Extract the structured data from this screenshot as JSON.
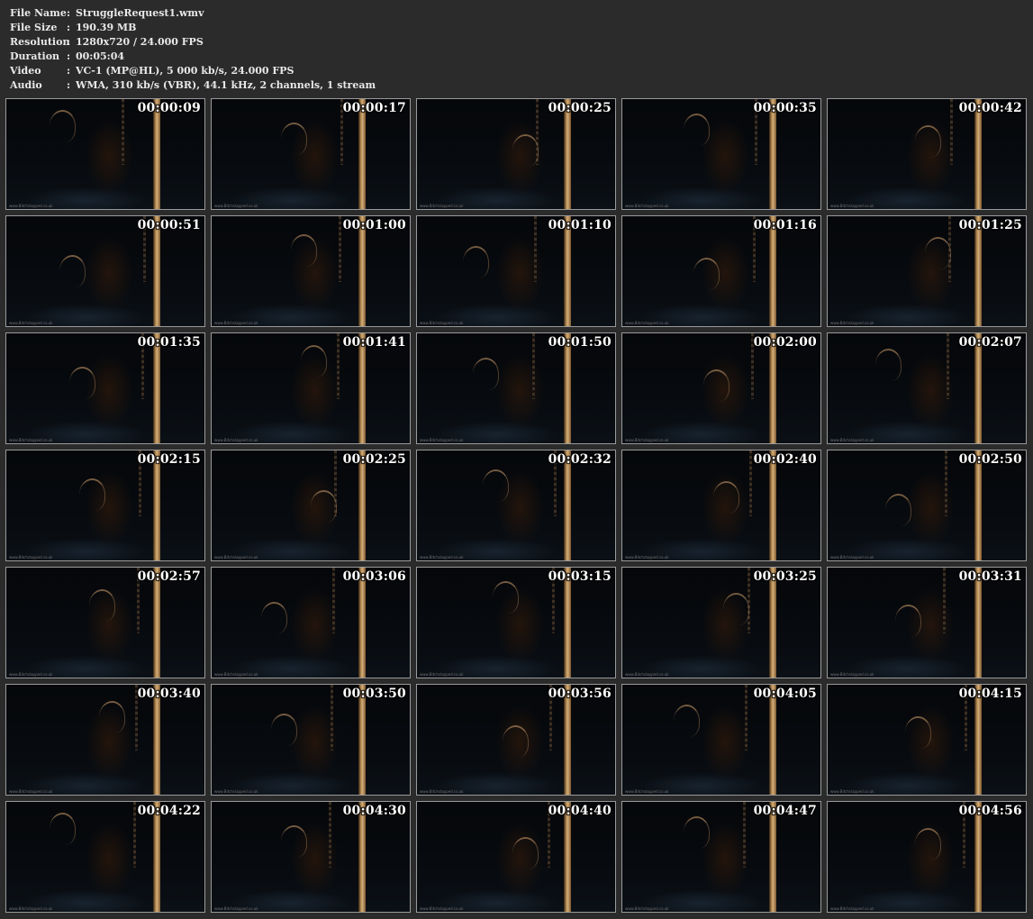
{
  "info": [
    {
      "label": "File Name",
      "value": "StruggleRequest1.wmv"
    },
    {
      "label": "File Size",
      "value": "190.39 MB"
    },
    {
      "label": "Resolution",
      "value": "1280x720 / 24.000 FPS"
    },
    {
      "label": "Duration",
      "value": "00:05:04"
    },
    {
      "label": "Video",
      "value": "VC-1 (MP@HL), 5 000 kb/s, 24.000 FPS"
    },
    {
      "label": "Audio",
      "value": "WMA, 310 kb/s (VBR), 44.1 kHz, 2 channels, 1 stream"
    }
  ],
  "colon": ":",
  "watermark": "www.Bitchslapped.co.uk",
  "thumbnails": [
    "00:00:09",
    "00:00:17",
    "00:00:25",
    "00:00:35",
    "00:00:42",
    "00:00:51",
    "00:01:00",
    "00:01:10",
    "00:01:16",
    "00:01:25",
    "00:01:35",
    "00:01:41",
    "00:01:50",
    "00:02:00",
    "00:02:07",
    "00:02:15",
    "00:02:25",
    "00:02:32",
    "00:02:40",
    "00:02:50",
    "00:02:57",
    "00:03:06",
    "00:03:15",
    "00:03:25",
    "00:03:31",
    "00:03:40",
    "00:03:50",
    "00:03:56",
    "00:04:05",
    "00:04:15",
    "00:04:22",
    "00:04:30",
    "00:04:40",
    "00:04:47",
    "00:04:56"
  ],
  "colors": {
    "background": "#2b2b2b",
    "info_text": "#e8e8e8",
    "thumb_border": "#9a9a9a",
    "timestamp": "#ffffff"
  }
}
